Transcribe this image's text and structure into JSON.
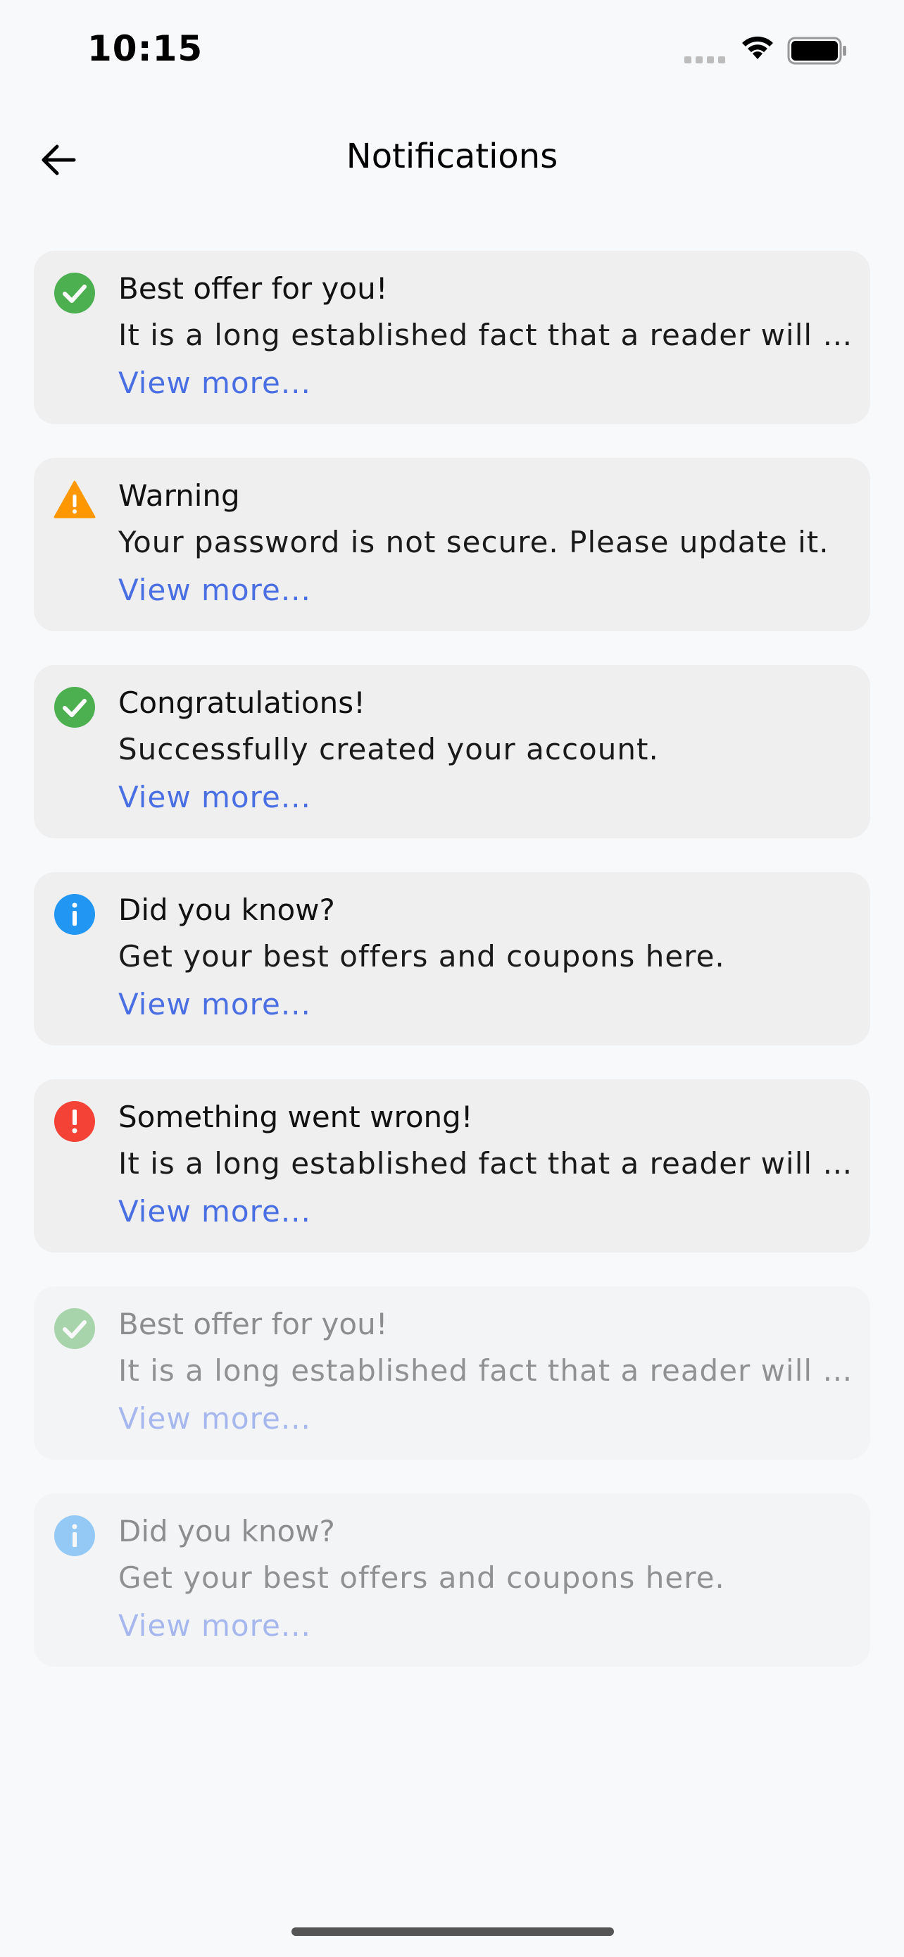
{
  "status_bar": {
    "time": "10:15"
  },
  "header": {
    "title": "Notifications",
    "back_icon": "arrow-left-icon"
  },
  "notifications": [
    {
      "icon": "success-check-icon",
      "icon_color": "#4caf50",
      "title": "Best offer for you!",
      "body": "It is a long established fact that a reader will be distracted",
      "link": "View more...",
      "read": false
    },
    {
      "icon": "warning-triangle-icon",
      "icon_color": "#ff9800",
      "title": "Warning",
      "body": "Your password is not secure. Please update it.",
      "link": "View more...",
      "read": false
    },
    {
      "icon": "success-check-icon",
      "icon_color": "#4caf50",
      "title": "Congratulations!",
      "body": "Successfully created your account.",
      "link": "View more...",
      "read": false
    },
    {
      "icon": "info-icon",
      "icon_color": "#2196f3",
      "title": "Did you know?",
      "body": "Get your best offers and coupons here.",
      "link": "View more...",
      "read": false
    },
    {
      "icon": "error-exclamation-icon",
      "icon_color": "#f44336",
      "title": "Something went wrong!",
      "body": "It is a long established fact that a reader will be distracted",
      "link": "View more...",
      "read": false
    },
    {
      "icon": "success-check-icon",
      "icon_color": "#4caf50",
      "title": "Best offer for you!",
      "body": "It is a long established fact that a reader will be distracted",
      "link": "View more...",
      "read": true
    },
    {
      "icon": "info-icon",
      "icon_color": "#2196f3",
      "title": "Did you know?",
      "body": "Get your best offers and coupons here.",
      "link": "View more...",
      "read": true
    }
  ]
}
